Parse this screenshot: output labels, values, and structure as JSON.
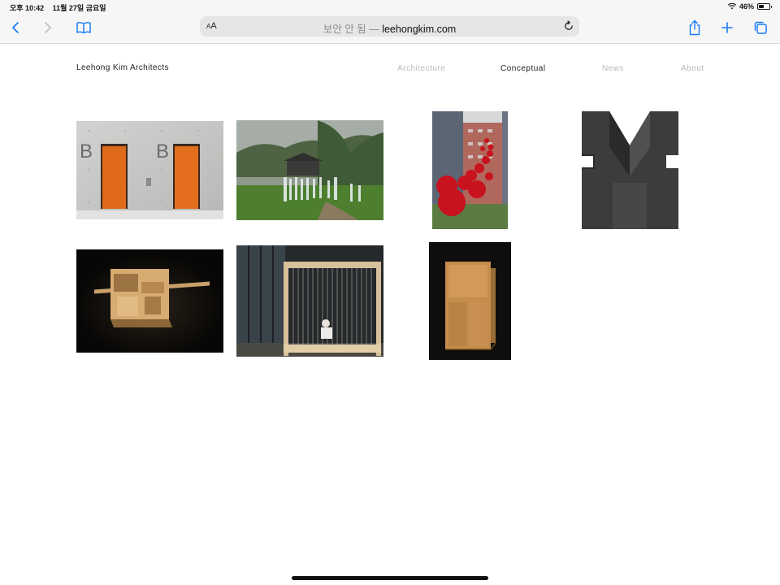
{
  "status": {
    "time": "오후 10:42",
    "date": "11월 27일 금요일",
    "battery": "46%",
    "battery_level": 0.46
  },
  "browser": {
    "reader_small": "A",
    "reader_large": "A",
    "security_label": "보안 안 됨 —",
    "host": "leehongkim.com"
  },
  "site": {
    "title": "Leehong Kim Architects",
    "nav": [
      {
        "label": "Architecture",
        "active": false
      },
      {
        "label": "Conceptual",
        "active": true
      },
      {
        "label": "News",
        "active": false
      },
      {
        "label": "About",
        "active": false
      }
    ]
  },
  "gallery": {
    "images": [
      {
        "subject": "concrete wall with orange doors"
      },
      {
        "subject": "field installation with white figures"
      },
      {
        "subject": "red balloons between buildings"
      },
      {
        "subject": "dark stone sculpture"
      },
      {
        "subject": "wooden architectural model"
      },
      {
        "subject": "pavilion with thread curtain"
      },
      {
        "subject": "wooden panel model"
      }
    ],
    "door_letter": "B"
  }
}
